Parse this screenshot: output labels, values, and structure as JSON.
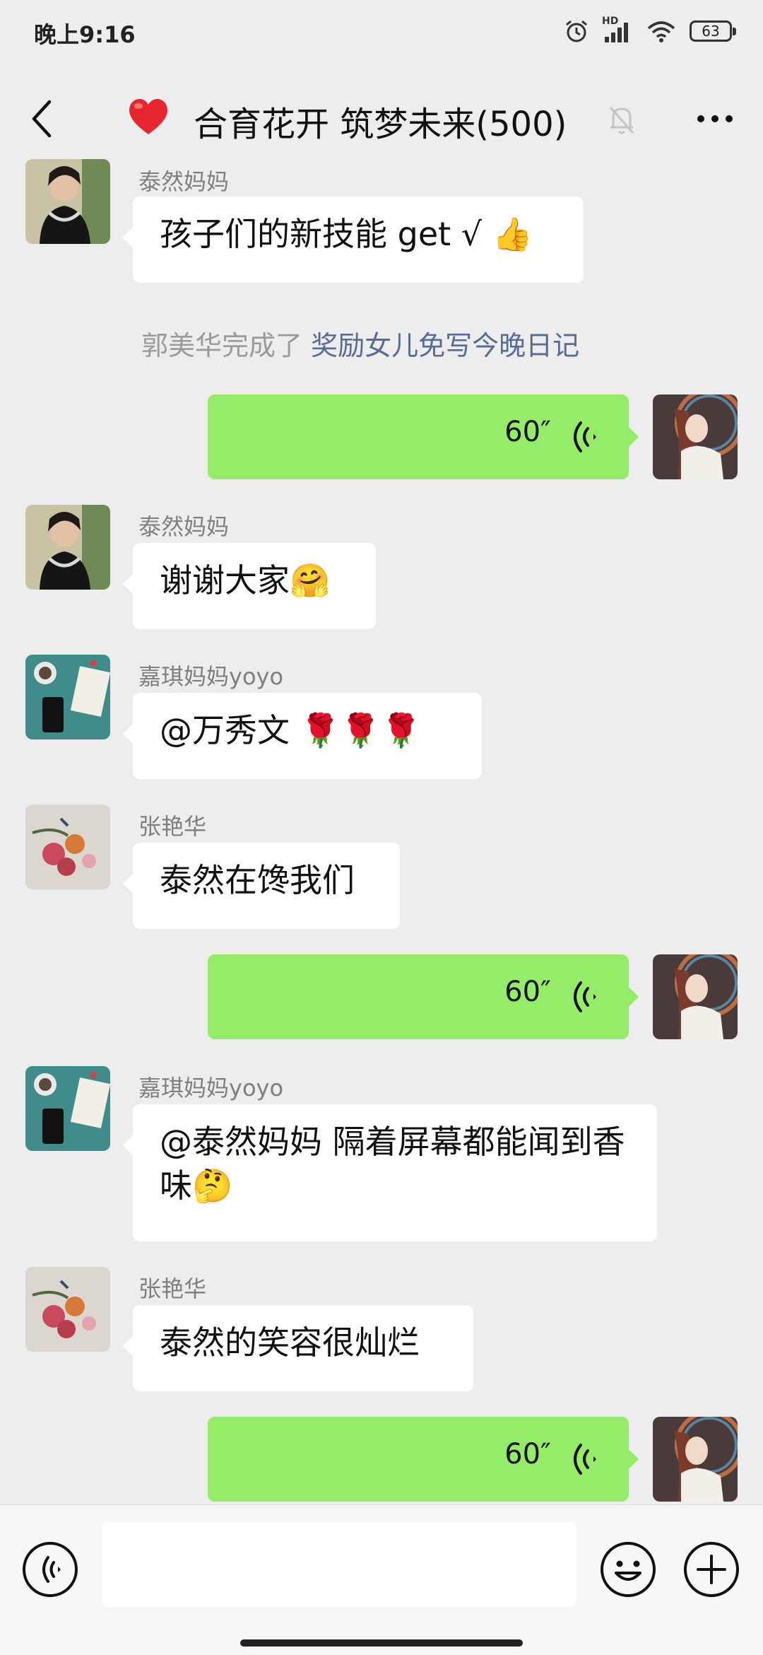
{
  "status_bar": {
    "time": "晚上9:16",
    "network": "HD",
    "battery": "63"
  },
  "header": {
    "title": "合育花开 筑梦未来(500)",
    "heart_icon": "red-heart-icon",
    "mute_icon": "bell-off-icon",
    "more_icon": "more-dots-icon"
  },
  "messages": [
    {
      "sender": "泰然妈妈",
      "text": "孩子们的新技能 get √ 👍"
    },
    {
      "system_prefix": "郭美华完成了 ",
      "system_link": "奖励女儿免写今晚日记"
    },
    {
      "voice_duration": "60″"
    },
    {
      "sender": "泰然妈妈",
      "text": "谢谢大家🤗"
    },
    {
      "sender": "嘉琪妈妈yoyo",
      "text": "@万秀文 🌹🌹🌹"
    },
    {
      "sender": "张艳华",
      "text": "泰然在馋我们"
    },
    {
      "voice_duration": "60″"
    },
    {
      "sender": "嘉琪妈妈yoyo",
      "text": "@泰然妈妈  隔着屏幕都能闻到香味🤔"
    },
    {
      "sender": "张艳华",
      "text": "泰然的笑容很灿烂"
    },
    {
      "voice_duration": "60″"
    }
  ],
  "input": {
    "placeholder": "",
    "value": ""
  },
  "colors": {
    "background": "#ededed",
    "self_bubble": "#95ec69",
    "other_bubble": "#ffffff",
    "link": "#576b95"
  }
}
